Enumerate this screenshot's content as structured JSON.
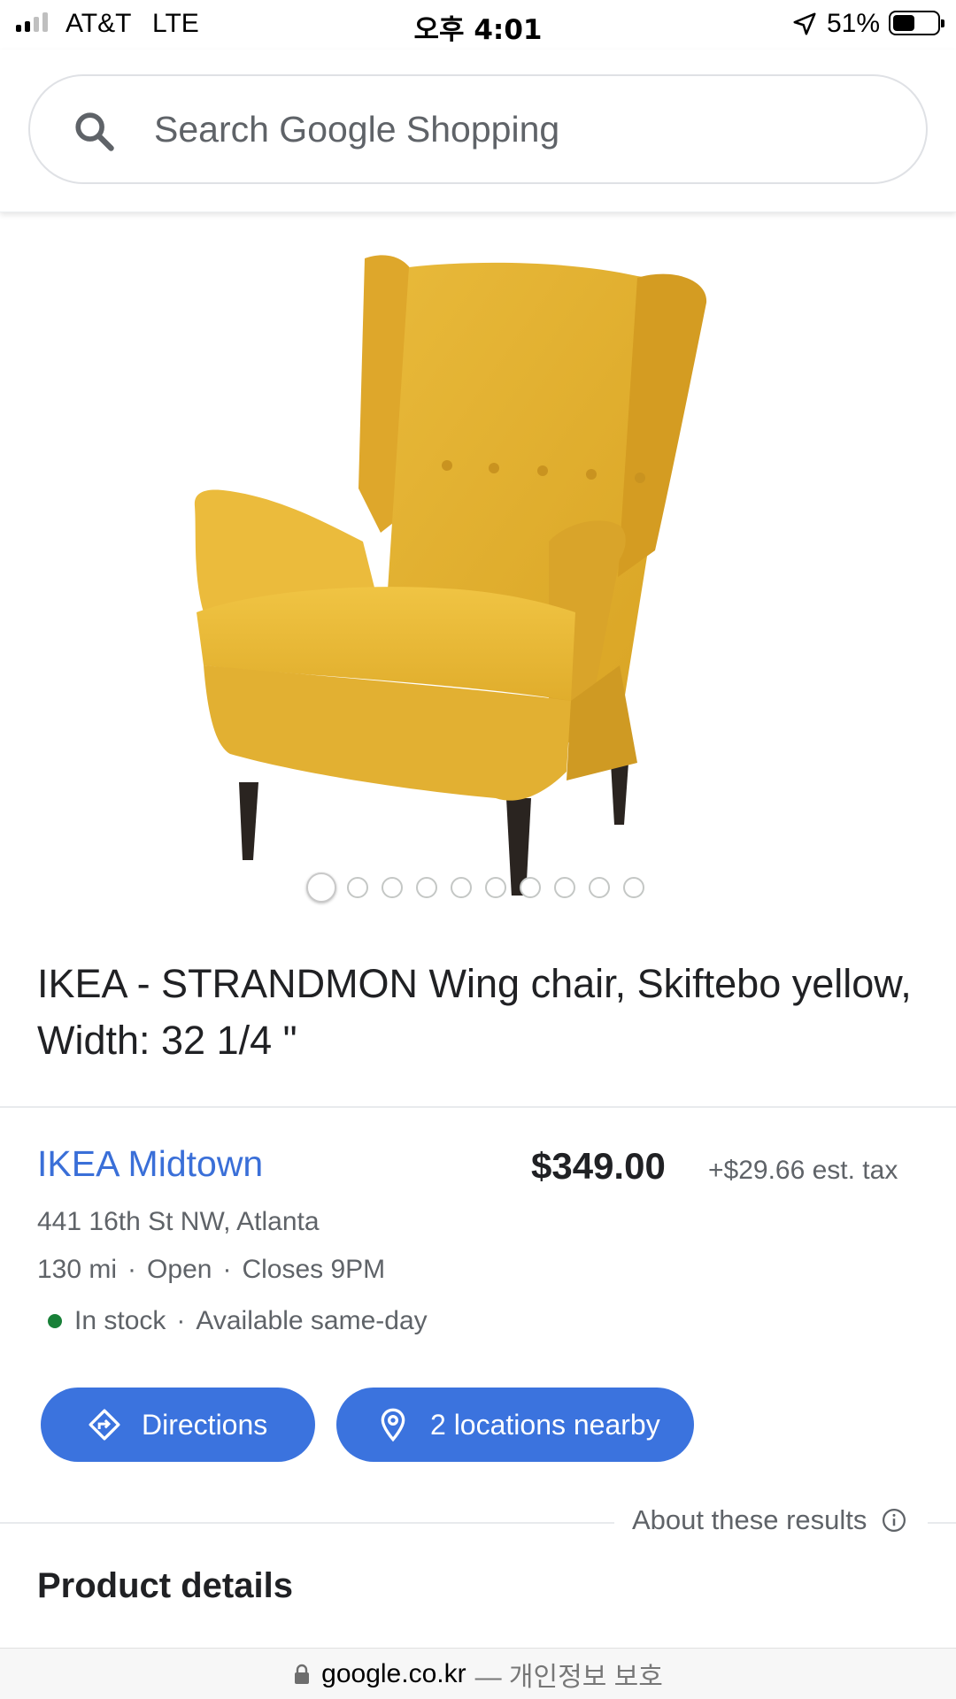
{
  "status_bar": {
    "carrier": "AT&T",
    "network": "LTE",
    "time": "오후 4:01",
    "battery_percent": "51%",
    "battery_level": 0.51
  },
  "search": {
    "placeholder": "Search Google Shopping",
    "icon": "search-icon"
  },
  "product": {
    "image_description_icon": "wing-chair",
    "image_count": 10,
    "active_image_index": 0,
    "title": "IKEA - STRANDMON Wing chair, Skiftebo yellow, Width: 32 1/4 \""
  },
  "store": {
    "name": "IKEA Midtown",
    "price": "$349.00",
    "tax": "+$29.66 est. tax",
    "address": "441 16th St NW, Atlanta",
    "distance": "130 mi",
    "open_status": "Open",
    "closes": "Closes 9PM",
    "stock_status": "In stock",
    "availability": "Available same-day",
    "stock_color": "#188038",
    "name_color": "#3a6fd8"
  },
  "actions": {
    "directions_label": "Directions",
    "locations_label": "2 locations nearby",
    "button_color": "#3b73de"
  },
  "about_label": "About these results",
  "section_title": "Product details",
  "url_bar": {
    "domain": "google.co.kr",
    "suffix": "— 개인정보 보호"
  }
}
